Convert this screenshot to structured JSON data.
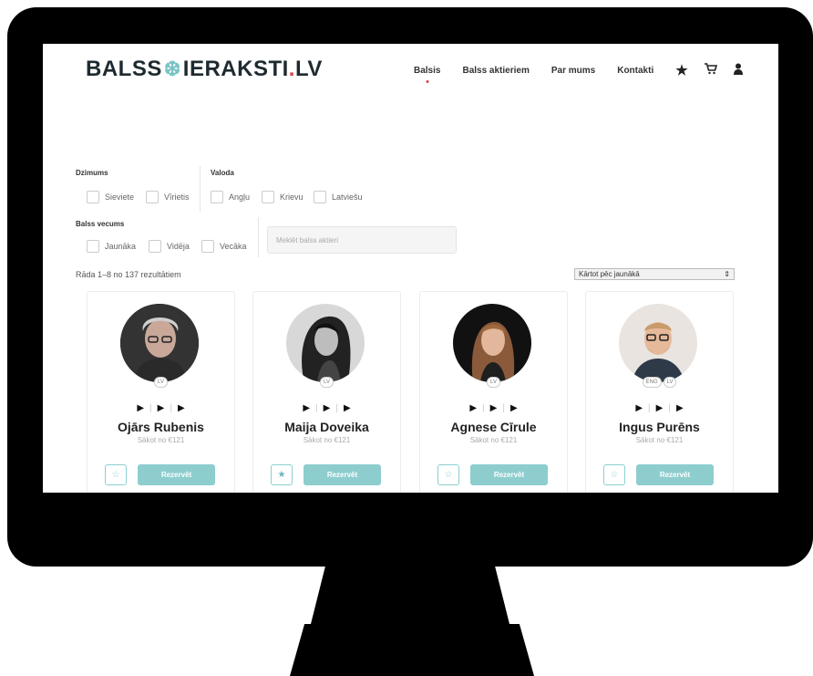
{
  "brand": {
    "part1": "BALSS",
    "tree_icon": "tree-icon",
    "part2": "IERAKSTI",
    "dot": ".",
    "part3": "LV"
  },
  "nav": [
    {
      "label": "Balsis",
      "active": true
    },
    {
      "label": "Balss aktieriem",
      "active": false
    },
    {
      "label": "Par mums",
      "active": false
    },
    {
      "label": "Kontakti",
      "active": false
    }
  ],
  "filters": {
    "gender_label": "Dzimums",
    "gender_options": [
      "Sieviete",
      "Vīrietis"
    ],
    "language_label": "Valoda",
    "language_options": [
      "Angļu",
      "Krievu",
      "Latviešu"
    ],
    "age_label": "Balss vecums",
    "age_options": [
      "Jaunāka",
      "Vidēja",
      "Vecāka"
    ],
    "search_placeholder": "Meklēt balss aktieri"
  },
  "results_text": "Rāda 1–8 no 137 rezultātiem",
  "sort_value": "Kārtot pēc jaunākā",
  "cards": [
    {
      "name": "Ojārs Rubenis",
      "price": "Sākot no €121",
      "badges": [
        "LV"
      ],
      "favorite": false,
      "button": "Rezervēt"
    },
    {
      "name": "Maija Doveika",
      "price": "Sākot no €121",
      "badges": [
        "LV"
      ],
      "favorite": true,
      "button": "Rezervēt"
    },
    {
      "name": "Agnese Cīrule",
      "price": "Sākot no €121",
      "badges": [
        "LV"
      ],
      "favorite": false,
      "button": "Rezervēt"
    },
    {
      "name": "Ingus Purēns",
      "price": "Sākot no €121",
      "badges": [
        "ENG",
        "LV"
      ],
      "favorite": false,
      "button": "Rezervēt"
    }
  ],
  "colors": {
    "accent": "#8dcdce",
    "brand_dark": "#1e2a2f",
    "brand_red": "#e0404a"
  }
}
